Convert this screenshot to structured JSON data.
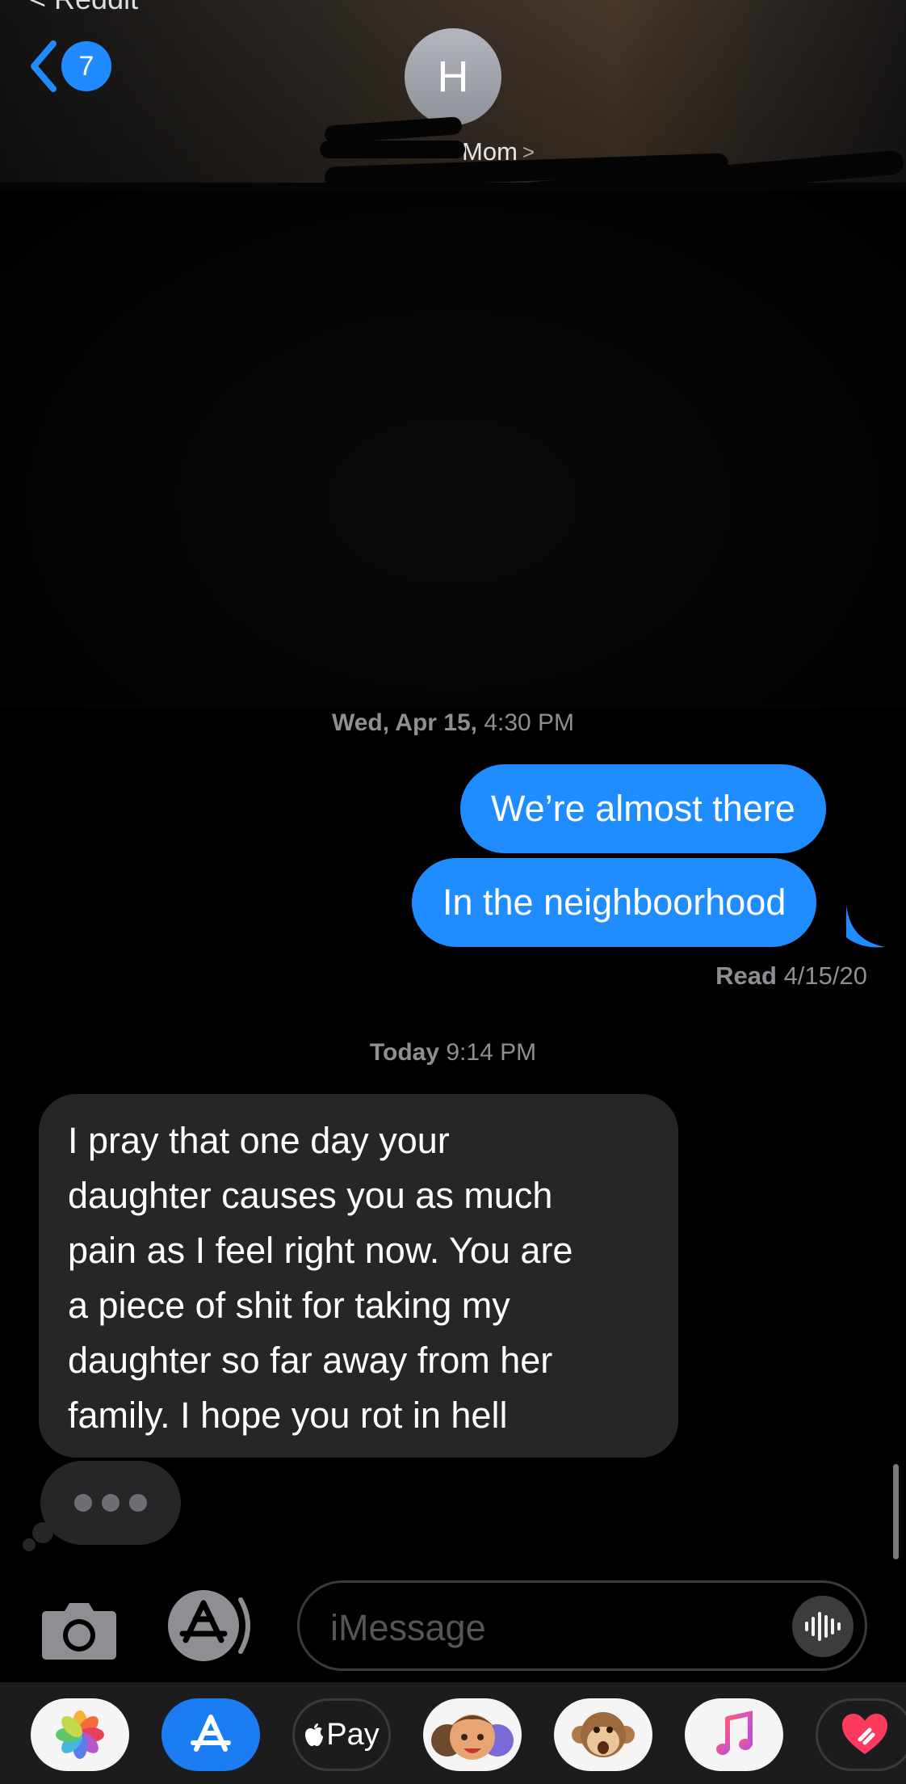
{
  "header": {
    "back_app_label": "< Reddit",
    "back_badge_count": "7",
    "avatar_initial": "H",
    "contact_name": "Mom",
    "contact_chevron": ">"
  },
  "conversation": {
    "timestamp_1": {
      "day": "Wed, Apr 15,",
      "time": "4:30 PM"
    },
    "outgoing": [
      {
        "text": "We’re almost there"
      },
      {
        "text": "In the neighboorhood"
      }
    ],
    "read_receipt": {
      "label": "Read",
      "date": "4/15/20"
    },
    "timestamp_2": {
      "day": "Today",
      "time": "9:14 PM"
    },
    "incoming": {
      "lines": [
        "I pray that one day your",
        "daughter causes you as much",
        "pain as I feel right now. You are",
        "a piece of shit for taking my",
        "daughter so far away from her",
        "family. I hope you rot in hell"
      ]
    },
    "typing_indicator": {
      "dots": 3
    }
  },
  "input_bar": {
    "placeholder": "iMessage",
    "camera_icon": "camera-icon",
    "apps_icon": "app-store-icon",
    "audio_icon": "audio-waveform-icon"
  },
  "app_drawer": {
    "apps": [
      {
        "name": "photos-app-icon"
      },
      {
        "name": "app-store-app-icon"
      },
      {
        "name": "apple-pay-app-icon",
        "label": "Pay"
      },
      {
        "name": "memoji-app-icon"
      },
      {
        "name": "animoji-app-icon"
      },
      {
        "name": "music-app-icon"
      },
      {
        "name": "digital-touch-app-icon"
      }
    ]
  },
  "colors": {
    "outgoing_bubble": "#1f8cff",
    "incoming_bubble": "#262628",
    "badge": "#1f8bff",
    "secondary_text": "#8e8e93"
  }
}
